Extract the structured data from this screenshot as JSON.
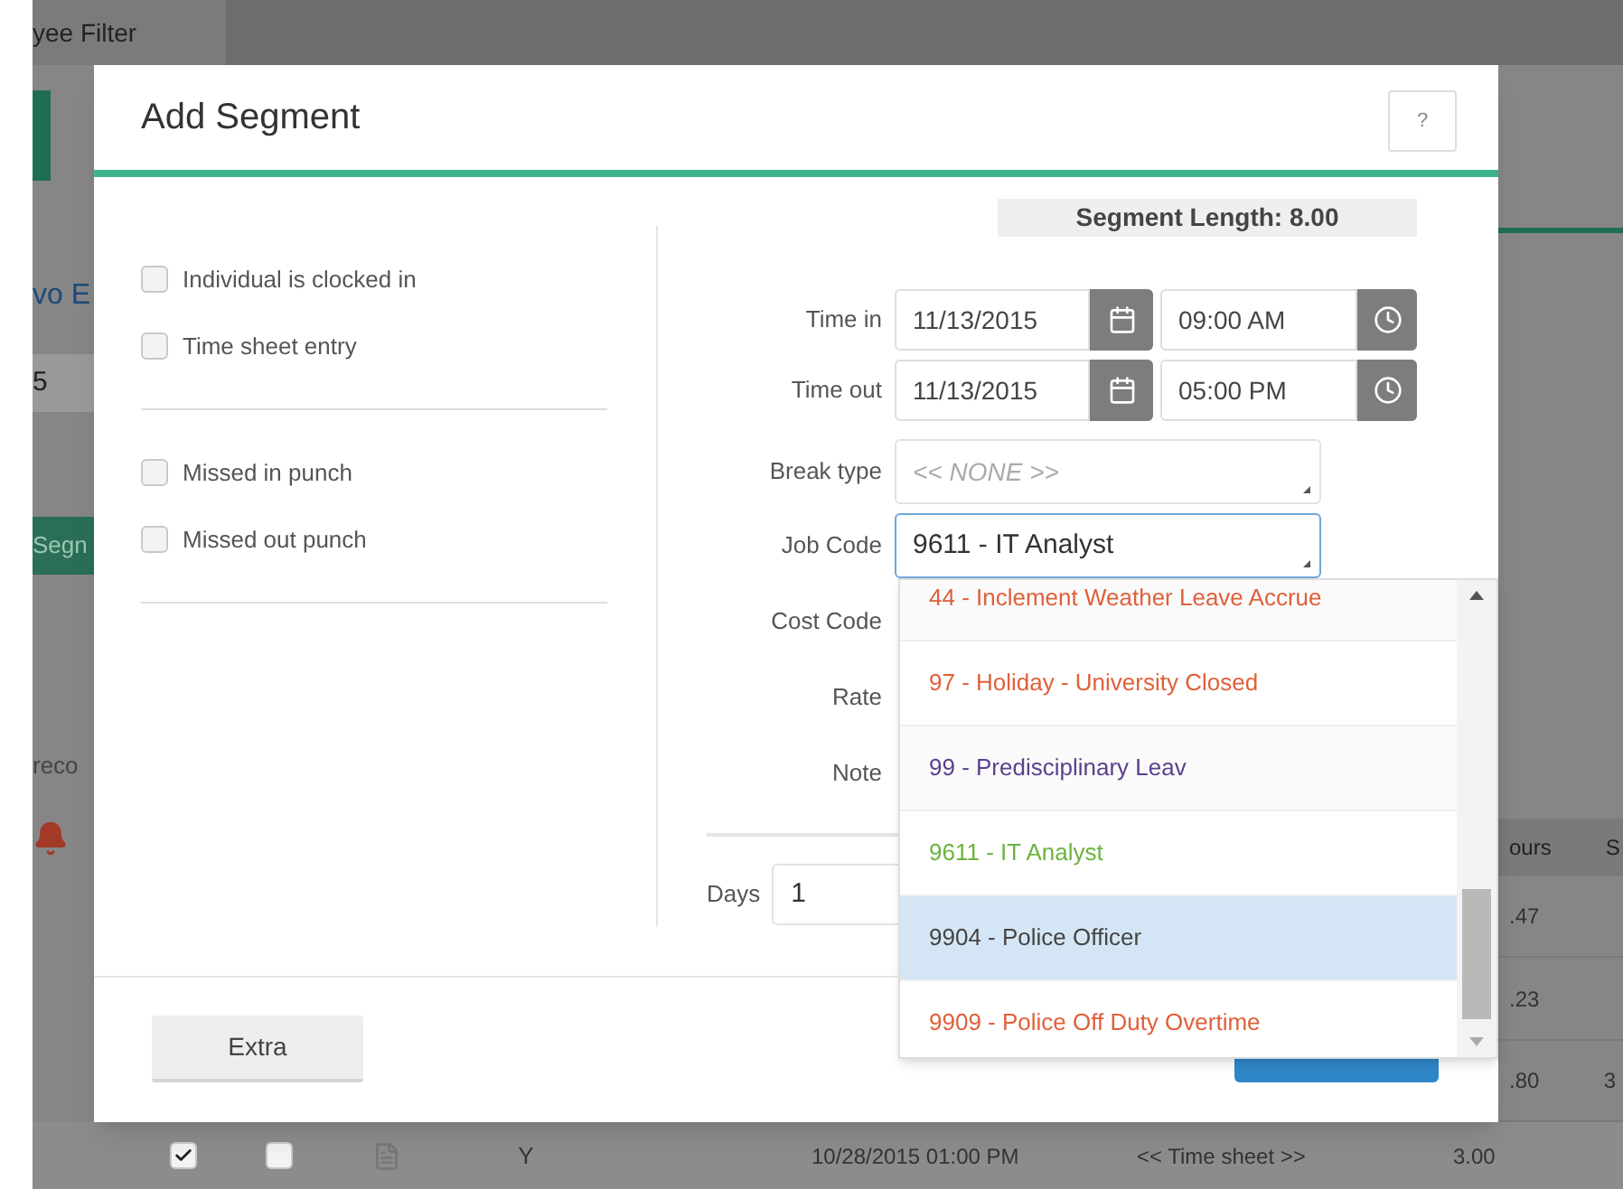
{
  "background": {
    "filter_tab": "yee Filter",
    "employee_name": "vo E",
    "date_fragment": "5",
    "segment_button": "Segn",
    "records_text": "reco",
    "hours_header": "ours",
    "column_header": "S",
    "hours_values": [
      ".47",
      ".23",
      ".80"
    ],
    "row_fragment": "3",
    "bottom_row": {
      "checks": [
        {
          "checked": true
        },
        {
          "checked": false
        }
      ],
      "flag": "Y",
      "time": "10/28/2015 01:00 PM",
      "source": "<< Time sheet >>",
      "hours": "3.00"
    }
  },
  "dialog": {
    "title": "Add Segment",
    "help": "?",
    "segment_length": "Segment Length: 8.00",
    "option_groups": [
      [
        {
          "label": "Individual is clocked in",
          "checked": false
        },
        {
          "label": "Time sheet entry",
          "checked": false
        }
      ],
      [
        {
          "label": "Missed in punch",
          "checked": false
        },
        {
          "label": "Missed out punch",
          "checked": false
        }
      ]
    ],
    "time_in": {
      "label": "Time in",
      "date": "11/13/2015",
      "time": "09:00 AM"
    },
    "time_out": {
      "label": "Time out",
      "date": "11/13/2015",
      "time": "05:00 PM"
    },
    "break_type": {
      "label": "Break type",
      "placeholder": "<< NONE >>"
    },
    "job_code": {
      "label": "Job Code",
      "value": "9611 - IT Analyst",
      "expanded": true
    },
    "cost_code": {
      "label": "Cost Code"
    },
    "rate": {
      "label": "Rate"
    },
    "note": {
      "label": "Note"
    },
    "days": {
      "label": "Days",
      "value": "1"
    },
    "job_code_options": [
      {
        "label": "44 - Inclement Weather Leave Accrue",
        "color": "#e0603a",
        "selected": false
      },
      {
        "label": "97 - Holiday - University Closed",
        "color": "#e0603a",
        "selected": false
      },
      {
        "label": "99 - Predisciplinary Leav",
        "color": "#5b3f8c",
        "selected": false
      },
      {
        "label": "9611 - IT Analyst",
        "color": "#6cb33f",
        "selected": false
      },
      {
        "label": "9904 - Police Officer",
        "color": "#444444",
        "selected": true
      },
      {
        "label": "9909 - Police Off Duty Overtime",
        "color": "#e0603a",
        "selected": false
      }
    ],
    "extra_button": "Extra"
  }
}
